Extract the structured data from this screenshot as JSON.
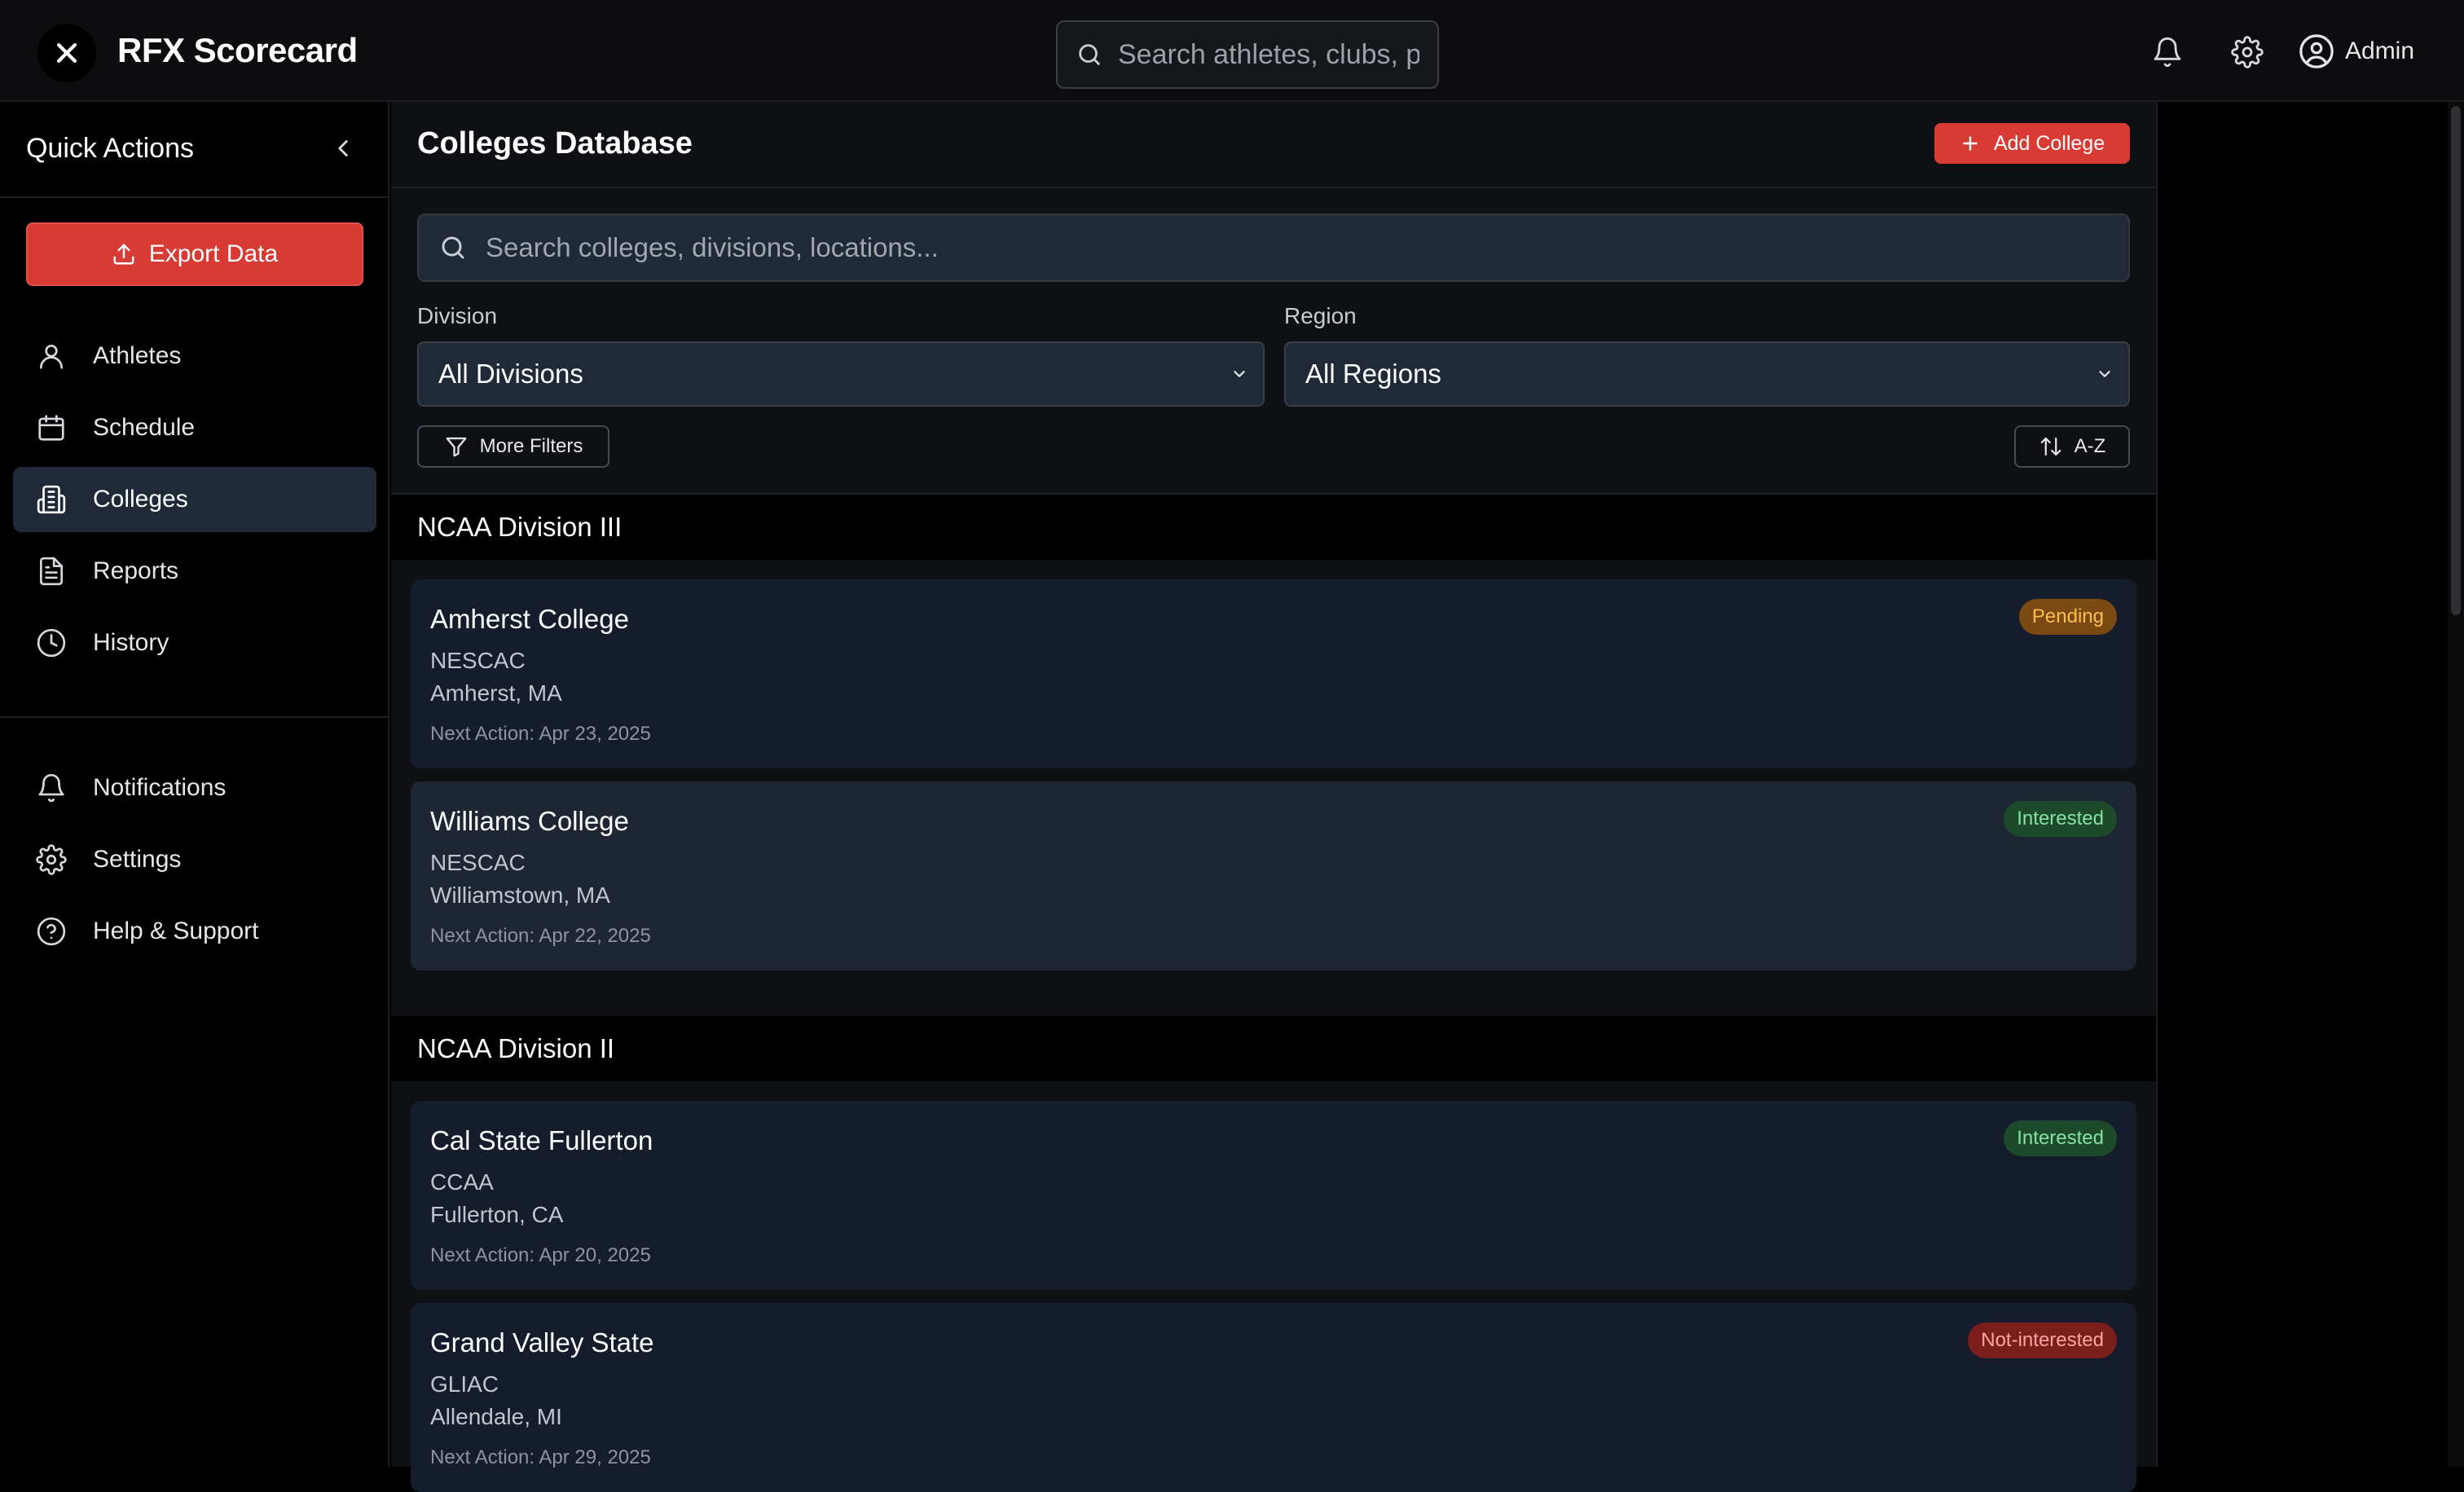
{
  "app": {
    "title": "RFX Scorecard"
  },
  "topbar": {
    "search_placeholder": "Search athletes, clubs, programs...",
    "user_label": "Admin"
  },
  "sidebar": {
    "title": "Quick Actions",
    "export_label": "Export Data",
    "primary_items": [
      {
        "label": "Athletes",
        "icon": "user-icon"
      },
      {
        "label": "Schedule",
        "icon": "calendar-icon"
      },
      {
        "label": "Colleges",
        "icon": "building-icon",
        "active": true
      },
      {
        "label": "Reports",
        "icon": "document-icon"
      },
      {
        "label": "History",
        "icon": "clock-icon"
      }
    ],
    "secondary_items": [
      {
        "label": "Notifications",
        "icon": "bell-icon"
      },
      {
        "label": "Settings",
        "icon": "gear-icon"
      },
      {
        "label": "Help & Support",
        "icon": "help-icon"
      }
    ]
  },
  "main": {
    "title": "Colleges Database",
    "add_label": "Add College",
    "search_placeholder": "Search colleges, divisions, locations...",
    "filters": {
      "division_label": "Division",
      "division_value": "All Divisions",
      "region_label": "Region",
      "region_value": "All Regions",
      "more_filters_label": "More Filters",
      "sort_label": "A-Z"
    },
    "groups": [
      {
        "name": "NCAA Division III",
        "colleges": [
          {
            "name": "Amherst College",
            "conference": "NESCAC",
            "location": "Amherst, MA",
            "next_action": "Next Action: Apr 23, 2025",
            "status": "Pending"
          },
          {
            "name": "Williams College",
            "conference": "NESCAC",
            "location": "Williamstown, MA",
            "next_action": "Next Action: Apr 22, 2025",
            "status": "Interested"
          }
        ]
      },
      {
        "name": "NCAA Division II",
        "colleges": [
          {
            "name": "Cal State Fullerton",
            "conference": "CCAA",
            "location": "Fullerton, CA",
            "next_action": "Next Action: Apr 20, 2025",
            "status": "Interested"
          },
          {
            "name": "Grand Valley State",
            "conference": "GLIAC",
            "location": "Allendale, MI",
            "next_action": "Next Action: Apr 29, 2025",
            "status": "Not-interested"
          }
        ]
      }
    ]
  },
  "status_colors": {
    "Pending": {
      "bg": "#7a4a12",
      "fg": "#fbbf4a"
    },
    "Interested": {
      "bg": "#1d4a2a",
      "fg": "#86e0a0"
    },
    "Not-interested": {
      "bg": "#7a1f1c",
      "fg": "#fca5a0"
    }
  },
  "colors": {
    "accent": "#d83a34",
    "active_nav": "#1f2937",
    "card": "#151c2b"
  }
}
